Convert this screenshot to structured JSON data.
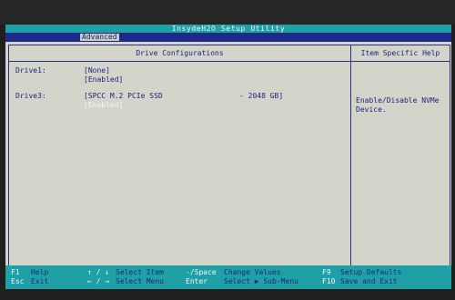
{
  "app_title": "InsydeH2O Setup Utility",
  "menu": {
    "active_tab": "Advanced"
  },
  "header": {
    "left": "Drive Configurations",
    "right": "Item Specific Help"
  },
  "drives": [
    {
      "label": "Drive1:",
      "value1": "[None]",
      "value2": "[Enabled]"
    },
    {
      "label": "Drive3:",
      "value1": "[SPCC M.2 PCIe SSD",
      "size": "- 2048 GB]",
      "value2": "[Enabled]"
    }
  ],
  "help": {
    "line1": "Enable/Disable NVMe",
    "line2": "Device."
  },
  "footer": {
    "f1_key": "F1",
    "f1_desc": "Help",
    "esc_key": "Esc",
    "esc_desc": "Exit",
    "updown_key": "↑ / ↓",
    "updown_desc": "Select Item",
    "leftright_key": "← / →",
    "leftright_desc": "Select Menu",
    "minus_key": "-/Space",
    "minus_desc": "Change Values",
    "enter_key": "Enter",
    "enter_desc": "Select ▶ Sub-Menu",
    "f9_key": "F9",
    "f9_desc": "Setup Defaults",
    "f10_key": "F10",
    "f10_desc": "Save and Exit"
  },
  "colors": {
    "background": "#d3d5cb",
    "title_bar": "#1fa0a6",
    "menu_bar": "#1e2a8a",
    "text": "#1d1f7c",
    "highlight": "#f6f6f0"
  }
}
